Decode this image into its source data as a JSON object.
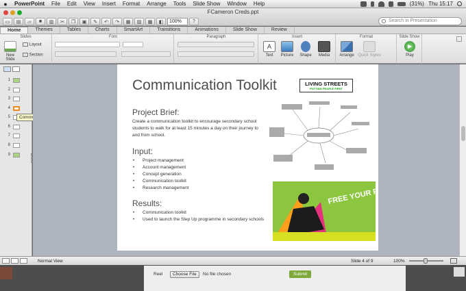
{
  "menubar": {
    "apple": "",
    "app": "PowerPoint",
    "items": [
      "File",
      "Edit",
      "View",
      "Insert",
      "Format",
      "Arrange",
      "Tools",
      "Slide Show",
      "Window",
      "Help"
    ],
    "battery": "(31%)",
    "clock": "Thu 15:17"
  },
  "window": {
    "doc_title": "FCameron Creds.ppt",
    "zoom": "100%",
    "search_placeholder": "Search in Presentation"
  },
  "tabs": [
    "Home",
    "Themes",
    "Tables",
    "Charts",
    "SmartArt",
    "Transitions",
    "Animations",
    "Slide Show",
    "Review"
  ],
  "ribbon": {
    "groups": {
      "slides": "Slides",
      "font": "Font",
      "paragraph": "Paragraph",
      "insert": "Insert",
      "format": "Format",
      "slideshow": "Slide Show"
    },
    "new_slide": "New Slide",
    "layout": "Layout",
    "section": "Section",
    "text": "Text",
    "picture": "Picture",
    "shape": "Shape",
    "media": "Media",
    "arrange": "Arrange",
    "quick_styles": "Quick Styles",
    "play": "Play"
  },
  "sidebar": {
    "slides": [
      "1",
      "2",
      "3",
      "4",
      "5",
      "6",
      "7",
      "8",
      "9"
    ],
    "tooltip": "Communication Toolkit"
  },
  "slide": {
    "title": "Communication Toolkit",
    "logo_line1": "LIVING STREETS",
    "logo_line2": "PUTTING PEOPLE FIRST",
    "brief_heading": "Project Brief:",
    "brief_text": "Create  a communication toolkit to encourage secondary school students to walk for at least 15 minutes a day on their journey to and from school.",
    "input_heading": "Input:",
    "input_items": [
      "Project management",
      "Account management",
      "Concept generation",
      "Communication toolkit",
      "Research management"
    ],
    "results_heading": "Results:",
    "results_items": [
      "Communication toolkit",
      "Used to launch the Step Up programme in secondary schools"
    ],
    "poster_text": "FREE YOUR FEET"
  },
  "status": {
    "view": "Normal View",
    "slide_pos": "Slide 4 of 9",
    "zoom": "100%"
  },
  "background_page": {
    "reel_label": "Reel",
    "choose_file": "Choose File",
    "no_file": "No file chosen",
    "submit": "Submit"
  },
  "colors": {
    "accent_green": "#7ea83a",
    "title_grey": "#4d4d4d"
  }
}
